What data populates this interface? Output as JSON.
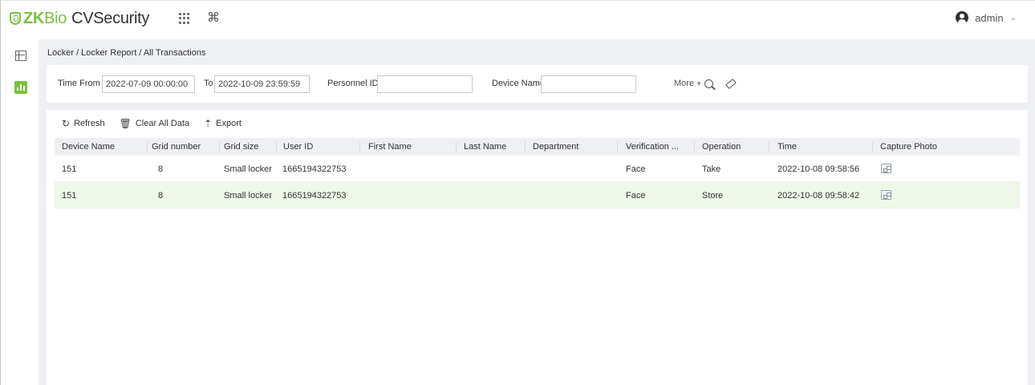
{
  "app": {
    "brand_zk": "ZK",
    "brand_bio": "Bio",
    "brand_product": "CVSecurity",
    "user_name": "admin"
  },
  "breadcrumb": "Locker / Locker Report / All Transactions",
  "filters": {
    "time_from_label": "Time From",
    "time_from_value": "2022-07-09 00:00:00",
    "to_label": "To",
    "to_value": "2022-10-09 23:59:59",
    "personnel_id_label": "Personnel ID",
    "personnel_id_value": "",
    "device_name_label": "Device Name",
    "device_name_value": "",
    "more_label": "More"
  },
  "toolbar": {
    "refresh_label": "Refresh",
    "clear_label": "Clear All Data",
    "export_label": "Export"
  },
  "table": {
    "headers": [
      "Device Name",
      "Grid number",
      "Grid size",
      "User ID",
      "First Name",
      "Last Name",
      "Department",
      "Verification ...",
      "Operation",
      "Time",
      "Capture Photo"
    ],
    "rows": [
      {
        "device_name": "151",
        "grid_number": "8",
        "grid_size": "Small locker",
        "user_id": "1665194322753",
        "first_name": "",
        "last_name": "",
        "department": "",
        "verification": "Face",
        "operation": "Take",
        "time": "2022-10-08 09:58:56",
        "photo_icon": "image-icon"
      },
      {
        "device_name": "151",
        "grid_number": "8",
        "grid_size": "Small locker",
        "user_id": "1665194322753",
        "first_name": "",
        "last_name": "",
        "department": "",
        "verification": "Face",
        "operation": "Store",
        "time": "2022-10-08 09:58:42",
        "photo_icon": "image-icon"
      }
    ]
  },
  "colors": {
    "brand_green": "#7ac143",
    "selected_row": "#eef7e8",
    "background": "#eef0f4"
  }
}
